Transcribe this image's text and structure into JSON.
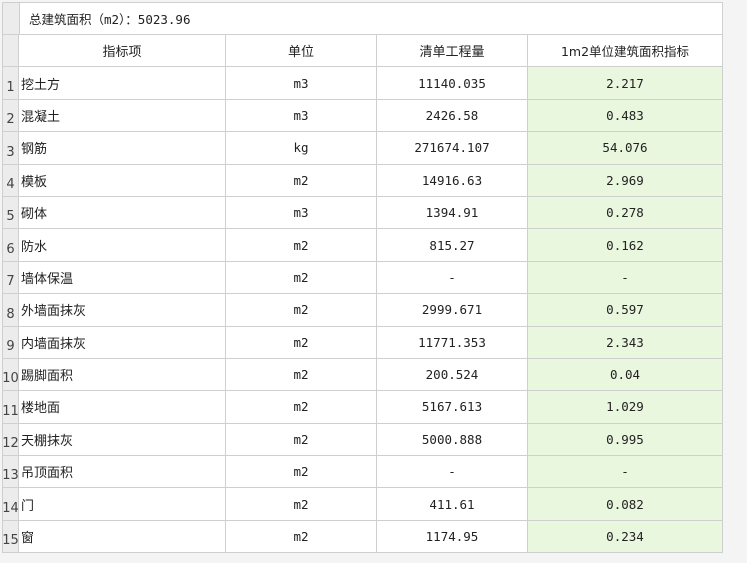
{
  "total": "总建筑面积（m2）：5023.96",
  "headers": {
    "item": "指标项",
    "unit": "单位",
    "qty": "清单工程量",
    "index": "1m2单位建筑面积指标"
  },
  "rows": [
    {
      "no": "1",
      "item": "挖土方",
      "unit": "m3",
      "qty": "11140.035",
      "index": "2.217"
    },
    {
      "no": "2",
      "item": "混凝土",
      "unit": "m3",
      "qty": "2426.58",
      "index": "0.483"
    },
    {
      "no": "3",
      "item": "钢筋",
      "unit": "kg",
      "qty": "271674.107",
      "index": "54.076"
    },
    {
      "no": "4",
      "item": "模板",
      "unit": "m2",
      "qty": "14916.63",
      "index": "2.969"
    },
    {
      "no": "5",
      "item": "砌体",
      "unit": "m3",
      "qty": "1394.91",
      "index": "0.278"
    },
    {
      "no": "6",
      "item": "防水",
      "unit": "m2",
      "qty": "815.27",
      "index": "0.162"
    },
    {
      "no": "7",
      "item": "墙体保温",
      "unit": "m2",
      "qty": "-",
      "index": "-"
    },
    {
      "no": "8",
      "item": "外墙面抹灰",
      "unit": "m2",
      "qty": "2999.671",
      "index": "0.597"
    },
    {
      "no": "9",
      "item": "内墙面抹灰",
      "unit": "m2",
      "qty": "11771.353",
      "index": "2.343"
    },
    {
      "no": "10",
      "item": "踢脚面积",
      "unit": "m2",
      "qty": "200.524",
      "index": "0.04"
    },
    {
      "no": "11",
      "item": "楼地面",
      "unit": "m2",
      "qty": "5167.613",
      "index": "1.029"
    },
    {
      "no": "12",
      "item": "天棚抹灰",
      "unit": "m2",
      "qty": "5000.888",
      "index": "0.995"
    },
    {
      "no": "13",
      "item": "吊顶面积",
      "unit": "m2",
      "qty": "-",
      "index": "-"
    },
    {
      "no": "14",
      "item": "门",
      "unit": "m2",
      "qty": "411.61",
      "index": "0.082"
    },
    {
      "no": "15",
      "item": "窗",
      "unit": "m2",
      "qty": "1174.95",
      "index": "0.234"
    }
  ],
  "colors": {
    "index_bg": "#eaf7df",
    "header_bg": "#ececec",
    "grid": "#cfcfcf"
  }
}
